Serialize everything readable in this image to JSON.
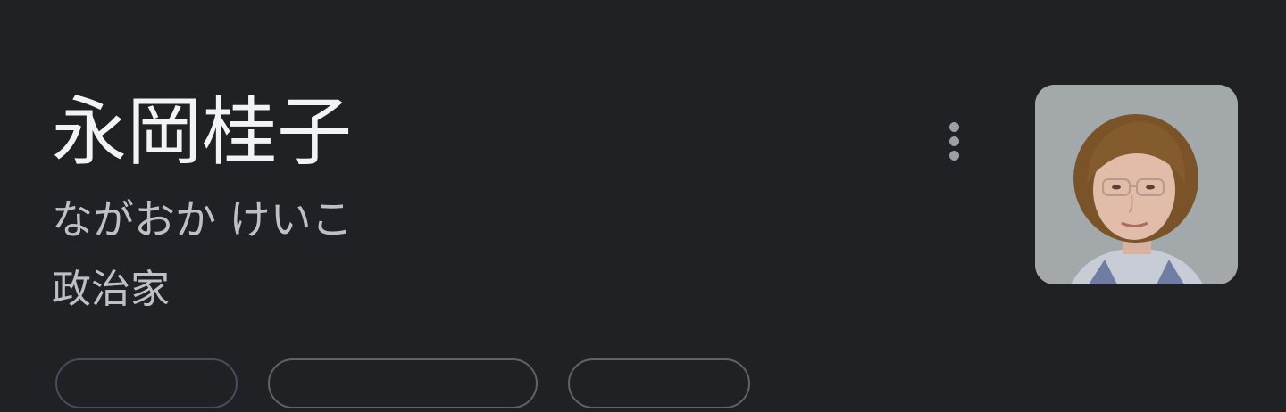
{
  "entity": {
    "name": "永岡桂子",
    "reading": "ながおか けいこ",
    "occupation": "政治家"
  },
  "icons": {
    "more": "more-vert-icon"
  },
  "colors": {
    "background": "#202124",
    "title_text": "#f1f3f4",
    "secondary_text": "#bdc1c6",
    "chip_border": "#5f6368"
  }
}
